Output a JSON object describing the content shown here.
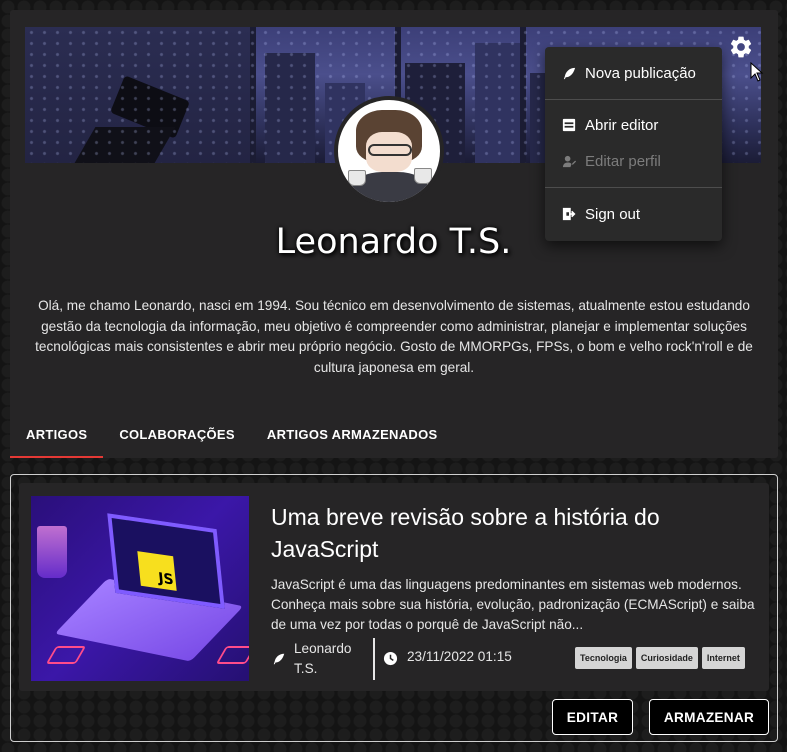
{
  "profile": {
    "name": "Leonardo T.S.",
    "bio": "Olá, me chamo Leonardo, nasci em 1994. Sou técnico em desenvolvimento de sistemas, atualmente estou estudando gestão da tecnologia da informação, meu objetivo é compreender como administrar, planejar e implementar soluções tecnológicas mais consistentes e abrir meu próprio negócio. Gosto de MMORPGs, FPSs, o bom e velho rock'n'roll e de cultura japonesa em geral."
  },
  "tabs": [
    {
      "label": "ARTIGOS",
      "active": true
    },
    {
      "label": "COLABORAÇÕES",
      "active": false
    },
    {
      "label": "ARTIGOS ARMAZENADOS",
      "active": false
    }
  ],
  "settings_menu": {
    "items": [
      {
        "label": "Nova publicação",
        "icon": "feather-icon",
        "disabled": false
      },
      {
        "label": "Abrir editor",
        "icon": "editor-icon",
        "disabled": false
      },
      {
        "label": "Editar perfil",
        "icon": "user-edit-icon",
        "disabled": true
      },
      {
        "label": "Sign out",
        "icon": "sign-out-icon",
        "disabled": false
      }
    ]
  },
  "article": {
    "title": "Uma breve revisão sobre a história do JavaScript",
    "description": "JavaScript é uma das linguagens predominantes em sistemas web modernos. Conheça mais sobre sua história, evolução, padronização (ECMAScript) e saiba de uma vez por todas o porquê de JavaScript não...",
    "author": "Leonardo T.S.",
    "date": "23/11/2022 01:15",
    "tags": [
      "Tecnologia",
      "Curiosidade",
      "Internet"
    ],
    "thumbnail_badge": "JS",
    "edit_label": "EDITAR",
    "archive_label": "ARMAZENAR"
  },
  "colors": {
    "active_tab_indicator": "#e53935",
    "card_background": "#262526",
    "js_yellow": "#f7df1e"
  }
}
